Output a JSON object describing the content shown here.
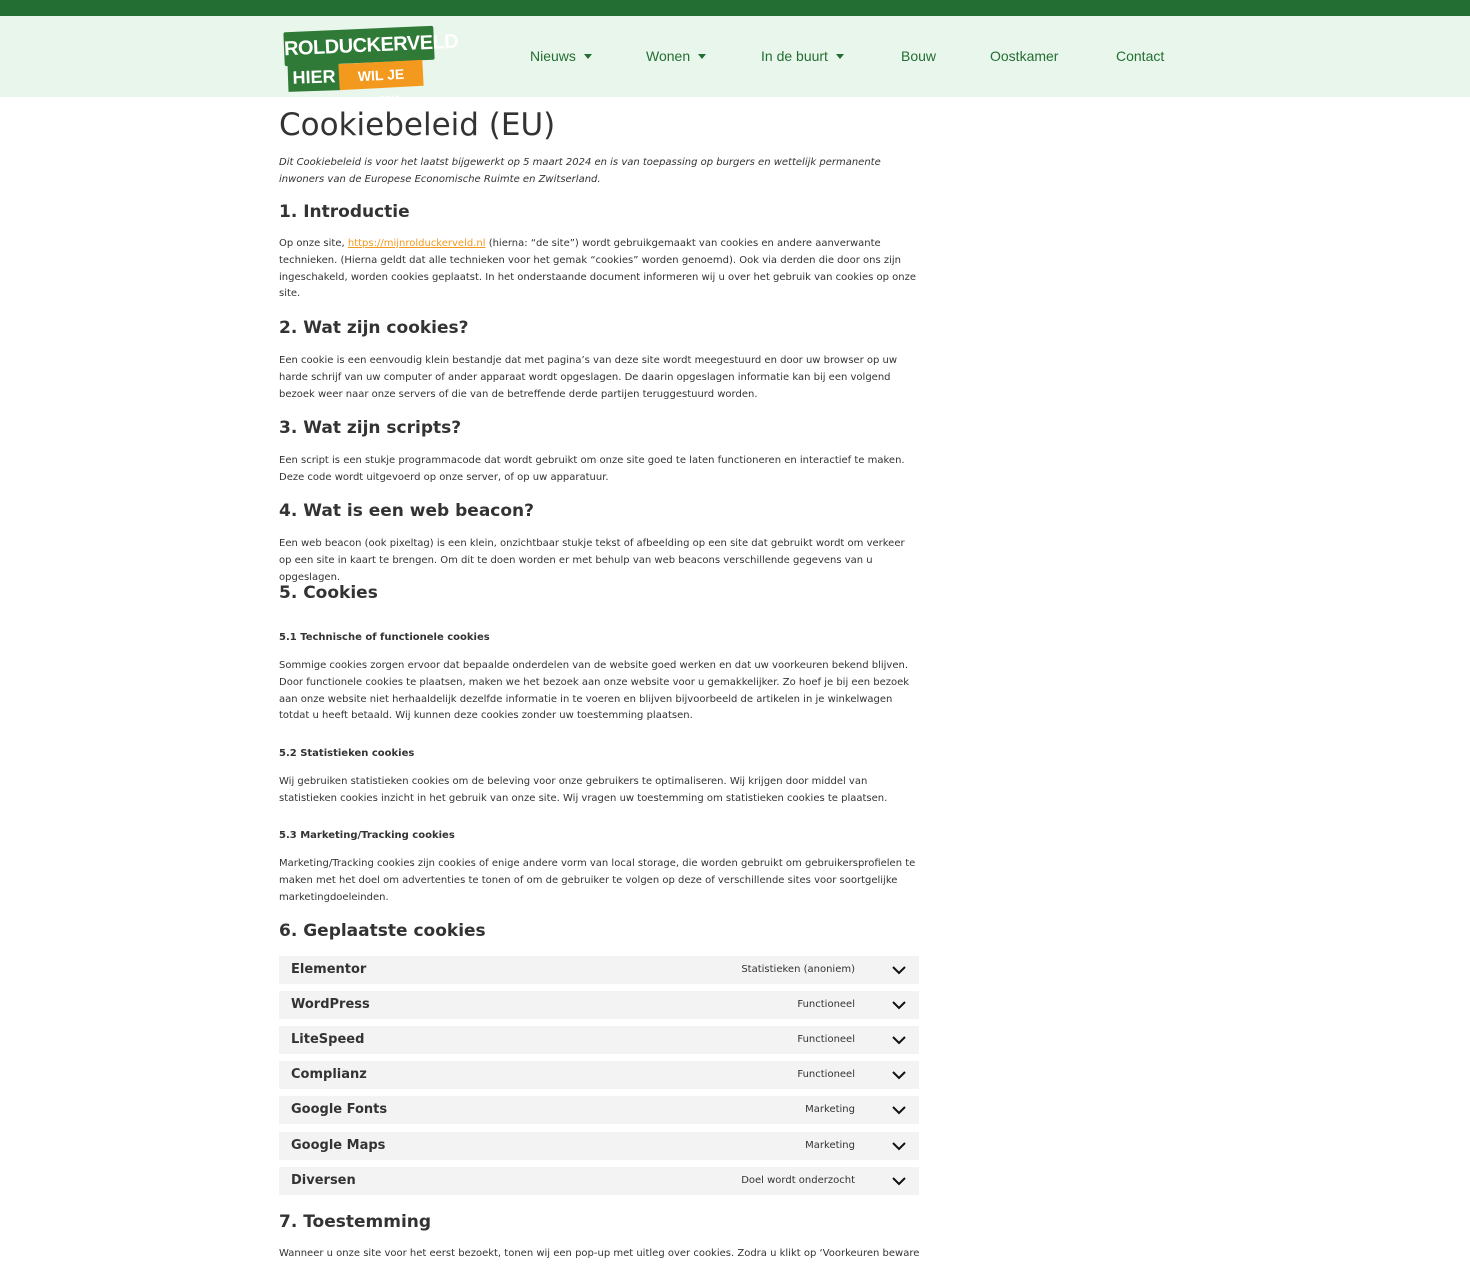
{
  "brand": {
    "logo_line1": "ROLDUCKERVELD",
    "logo_line2a": "HIER",
    "logo_line2b": "WIL JE ZIJN!",
    "colors": {
      "dark_green": "#236e32",
      "header_bg": "#e9f6ec",
      "accent_orange": "#f39a1e",
      "row_bg": "#f3f3f3"
    }
  },
  "nav": {
    "items": [
      {
        "label": "Nieuws",
        "has_dropdown": true
      },
      {
        "label": "Wonen",
        "has_dropdown": true
      },
      {
        "label": "In de buurt",
        "has_dropdown": true
      },
      {
        "label": "Bouw",
        "has_dropdown": false
      },
      {
        "label": "Oostkamer",
        "has_dropdown": false
      },
      {
        "label": "Contact",
        "has_dropdown": false
      }
    ]
  },
  "page": {
    "title": "Cookiebeleid (EU)",
    "intro_note": "Dit Cookiebeleid is voor het laatst bijgewerkt op 5 maart 2024 en is van toepassing op burgers en wettelijk permanente inwoners van de Europese Economische Ruimte en Zwitserland."
  },
  "sections": {
    "s1": {
      "heading": "1. Introductie",
      "text_before_link": "Op onze site, ",
      "link": "https://mijnrolduckerveld.nl",
      "text_after_link": " (hierna: “de site”) wordt gebruikgemaakt van cookies en andere aanverwante technieken. (Hierna geldt dat alle technieken voor het gemak “cookies” worden genoemd). Ook via derden die door ons zijn ingeschakeld, worden cookies geplaatst. In het onderstaande document informeren wij u over het gebruik van cookies op onze site."
    },
    "s2": {
      "heading": "2. Wat zijn cookies?",
      "text": "Een cookie is een eenvoudig klein bestandje dat met pagina’s van deze site wordt meegestuurd en door uw browser op uw harde schrijf van uw computer of ander apparaat wordt opgeslagen. De daarin opgeslagen informatie kan bij een volgend bezoek weer naar onze servers of die van de betreffende derde partijen teruggestuurd worden."
    },
    "s3": {
      "heading": "3. Wat zijn scripts?",
      "text": "Een script is een stukje programmacode dat wordt gebruikt om onze site goed te laten functioneren en interactief te maken. Deze code wordt uitgevoerd op onze server, of op uw apparatuur."
    },
    "s4": {
      "heading": "4. Wat is een web beacon?",
      "text": "Een web beacon (ook pixeltag) is een klein, onzichtbaar stukje tekst of afbeelding op een site dat gebruikt wordt om verkeer op een site in kaart te brengen. Om dit te doen worden er met behulp van web beacons verschillende gegevens van u opgeslagen."
    },
    "s5": {
      "heading": "5. Cookies",
      "sub1_heading": "5.1 Technische of functionele cookies",
      "sub1_text": "Sommige cookies zorgen ervoor dat bepaalde onderdelen van de website goed werken en dat uw voorkeuren bekend blijven. Door functionele cookies te plaatsen, maken we het bezoek aan onze website voor u gemakkelijker. Zo hoef je bij een bezoek aan onze website niet herhaaldelijk dezelfde informatie in te voeren en blijven bijvoorbeeld de artikelen in je winkelwagen totdat u heeft betaald. Wij kunnen deze cookies zonder uw toestemming plaatsen.",
      "sub2_heading": "5.2 Statistieken cookies",
      "sub2_text": "Wij gebruiken statistieken cookies om de beleving voor onze gebruikers te optimaliseren. Wij krijgen door middel van statistieken cookies inzicht in het gebruik van onze site. Wij vragen uw toestemming om statistieken cookies te plaatsen.",
      "sub3_heading": "5.3 Marketing/Tracking cookies",
      "sub3_text": "Marketing/Tracking cookies zijn cookies of enige andere vorm van local storage, die worden gebruikt om gebruikersprofielen te maken met het doel om advertenties te tonen of om de gebruiker te volgen op deze of verschillende sites voor soortgelijke marketingdoeleinden."
    },
    "s6": {
      "heading": "6. Geplaatste cookies",
      "rows": [
        {
          "name": "Elementor",
          "category": "Statistieken (anoniem)"
        },
        {
          "name": "WordPress",
          "category": "Functioneel"
        },
        {
          "name": "LiteSpeed",
          "category": "Functioneel"
        },
        {
          "name": "Complianz",
          "category": "Functioneel"
        },
        {
          "name": "Google Fonts",
          "category": "Marketing"
        },
        {
          "name": "Google Maps",
          "category": "Marketing"
        },
        {
          "name": "Diversen",
          "category": "Doel wordt onderzocht"
        }
      ],
      "chevron_icon": "chevron-down-icon"
    },
    "s7": {
      "heading": "7. Toestemming",
      "text": "Wanneer u onze site voor het eerst bezoekt, tonen wij een pop-up met uitleg over cookies. Zodra u klikt op ‘Voorkeuren bewaren’"
    }
  }
}
